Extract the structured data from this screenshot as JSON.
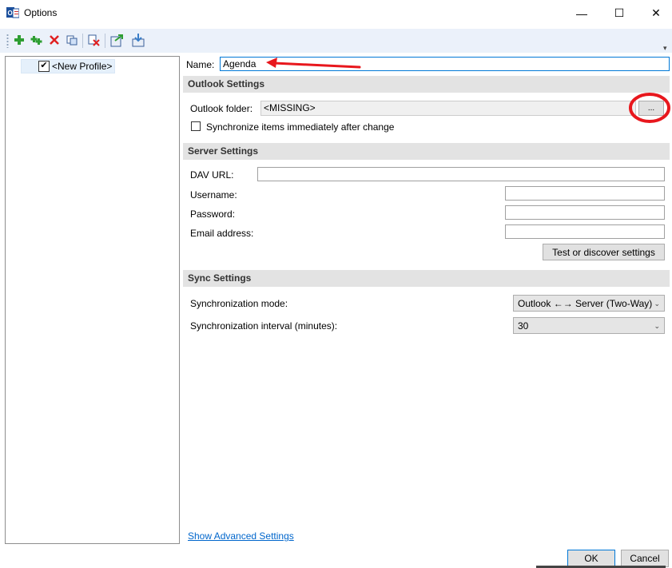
{
  "window": {
    "title": "Options",
    "icon": "outlook-caldav-icon",
    "minimize_glyph": "—",
    "maximize_glyph": "☐",
    "close_glyph": "✕"
  },
  "toolbar": {
    "items": [
      {
        "name": "add-profile-icon"
      },
      {
        "name": "add-multiple-profiles-icon"
      },
      {
        "name": "delete-profile-icon"
      },
      {
        "name": "copy-profile-icon"
      },
      {
        "name": "clear-cache-icon"
      },
      {
        "name": "export-options-icon"
      },
      {
        "name": "import-options-icon"
      }
    ],
    "overflow_glyph": "▾"
  },
  "tree": {
    "items": [
      {
        "label": "<New Profile>",
        "checked": true
      }
    ],
    "check_glyph": "✔"
  },
  "profile": {
    "name_label": "Name:",
    "name_value": "Agenda"
  },
  "outlook_settings": {
    "header": "Outlook Settings",
    "folder_label": "Outlook folder:",
    "folder_value": "<MISSING>",
    "browse_label": "...",
    "sync_immediately_label": "Synchronize items immediately after change",
    "sync_immediately_checked": false
  },
  "server_settings": {
    "header": "Server Settings",
    "dav_url_label": "DAV URL:",
    "dav_url_value": "",
    "username_label": "Username:",
    "username_value": "",
    "password_label": "Password:",
    "password_value": "",
    "email_label": "Email address:",
    "email_value": "",
    "test_button_label": "Test or discover settings"
  },
  "sync_settings": {
    "header": "Sync Settings",
    "mode_label": "Synchronization mode:",
    "mode_value": "Outlook ←→ Server (Two-Way)",
    "interval_label": "Synchronization interval (minutes):",
    "interval_value": "30"
  },
  "footer": {
    "advanced_link": "Show Advanced Settings",
    "ok_label": "OK",
    "cancel_label": "Cancel"
  },
  "annotations": {
    "arrow_color": "#e8171d",
    "circle_color": "#e8171d"
  }
}
